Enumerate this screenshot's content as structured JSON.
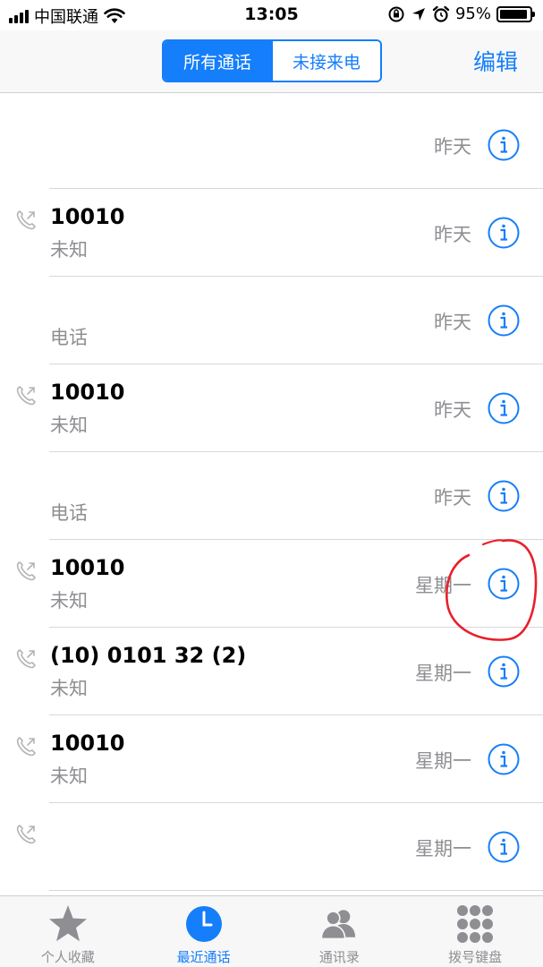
{
  "status_bar": {
    "carrier": "中国联通",
    "time": "13:05",
    "battery_percent_label": "95%",
    "battery_level": 0.95
  },
  "nav": {
    "segments": [
      "所有通话",
      "未接来电"
    ],
    "active_segment": 0,
    "edit_label": "编辑"
  },
  "calls": [
    {
      "number": "",
      "label": "",
      "day": "昨天",
      "show_icon": false
    },
    {
      "number": "10010",
      "label": "未知",
      "day": "昨天",
      "show_icon": true
    },
    {
      "number": "",
      "label": "电话",
      "day": "昨天",
      "show_icon": false
    },
    {
      "number": "10010",
      "label": "未知",
      "day": "昨天",
      "show_icon": true
    },
    {
      "number": "",
      "label": "电话",
      "day": "昨天",
      "show_icon": false
    },
    {
      "number": "10010",
      "label": "未知",
      "day": "星期一",
      "show_icon": true
    },
    {
      "number": "(10) 0101 32 (2)",
      "label": "未知",
      "day": "星期一",
      "show_icon": true
    },
    {
      "number": "10010",
      "label": "未知",
      "day": "星期一",
      "show_icon": true
    },
    {
      "number": "",
      "label": "",
      "day": "星期一",
      "show_icon": true
    }
  ],
  "tabs": [
    {
      "label": "个人收藏",
      "icon": "star-icon"
    },
    {
      "label": "最近通话",
      "icon": "clock-icon",
      "active": true
    },
    {
      "label": "通讯录",
      "icon": "contacts-icon"
    },
    {
      "label": "拨号键盘",
      "icon": "keypad-icon"
    }
  ],
  "colors": {
    "accent": "#147efb",
    "secondary_text": "#8e8e93",
    "annotation": "#e8202a"
  }
}
